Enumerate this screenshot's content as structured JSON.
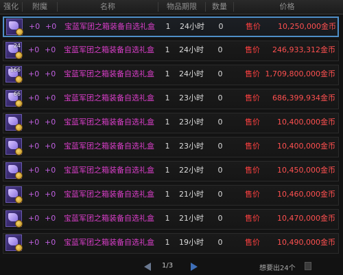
{
  "header": {
    "columns": [
      "强化",
      "附魔",
      "名称",
      "物品期限",
      "数量",
      "价格"
    ]
  },
  "rows": [
    {
      "enhance": "+0",
      "enchant": "+0",
      "name": "宝蓝军团之箱装备自选礼盒",
      "count": "1",
      "duration": "24小时",
      "qty": "0",
      "sell_label": "售价",
      "price": "10,250,000金币",
      "stack": "",
      "selected": true
    },
    {
      "enhance": "+0",
      "enchant": "+0",
      "name": "宝蓝军团之箱装备自选礼盒",
      "count": "1",
      "duration": "24小时",
      "qty": "0",
      "sell_label": "售价",
      "price": "246,933,312金币",
      "stack": "24",
      "selected": false
    },
    {
      "enhance": "+0",
      "enchant": "+0",
      "name": "宝蓝军团之箱装备自选礼盒",
      "count": "1",
      "duration": "24小时",
      "qty": "0",
      "sell_label": "售价",
      "price": "1,709,800,000金币",
      "stack": "166",
      "selected": false
    },
    {
      "enhance": "+0",
      "enchant": "+0",
      "name": "宝蓝军团之箱装备自选礼盒",
      "count": "1",
      "duration": "23小时",
      "qty": "0",
      "sell_label": "售价",
      "price": "686,399,934金币",
      "stack": "66",
      "selected": false
    },
    {
      "enhance": "+0",
      "enchant": "+0",
      "name": "宝蓝军团之箱装备自选礼盒",
      "count": "1",
      "duration": "23小时",
      "qty": "0",
      "sell_label": "售价",
      "price": "10,400,000金币",
      "stack": "",
      "selected": false
    },
    {
      "enhance": "+0",
      "enchant": "+0",
      "name": "宝蓝军团之箱装备自选礼盒",
      "count": "1",
      "duration": "23小时",
      "qty": "0",
      "sell_label": "售价",
      "price": "10,400,000金币",
      "stack": "",
      "selected": false
    },
    {
      "enhance": "+0",
      "enchant": "+0",
      "name": "宝蓝军团之箱装备自选礼盒",
      "count": "1",
      "duration": "22小时",
      "qty": "0",
      "sell_label": "售价",
      "price": "10,450,000金币",
      "stack": "",
      "selected": false
    },
    {
      "enhance": "+0",
      "enchant": "+0",
      "name": "宝蓝军团之箱装备自选礼盒",
      "count": "1",
      "duration": "21小时",
      "qty": "0",
      "sell_label": "售价",
      "price": "10,460,000金币",
      "stack": "",
      "selected": false
    },
    {
      "enhance": "+0",
      "enchant": "+0",
      "name": "宝蓝军团之箱装备自选礼盒",
      "count": "1",
      "duration": "21小时",
      "qty": "0",
      "sell_label": "售价",
      "price": "10,470,000金币",
      "stack": "",
      "selected": false
    },
    {
      "enhance": "+0",
      "enchant": "+0",
      "name": "宝蓝军团之箱装备自选礼盒",
      "count": "1",
      "duration": "19小时",
      "qty": "0",
      "sell_label": "售价",
      "price": "10,490,000金币",
      "stack": "",
      "selected": false
    }
  ],
  "footer": {
    "page": "1/3",
    "sold_count": "想要出24个"
  },
  "icons": {
    "prev": "chevron-left-icon",
    "next": "chevron-right-icon",
    "item": "gem-box-icon",
    "coin": "gold-coin-icon"
  }
}
